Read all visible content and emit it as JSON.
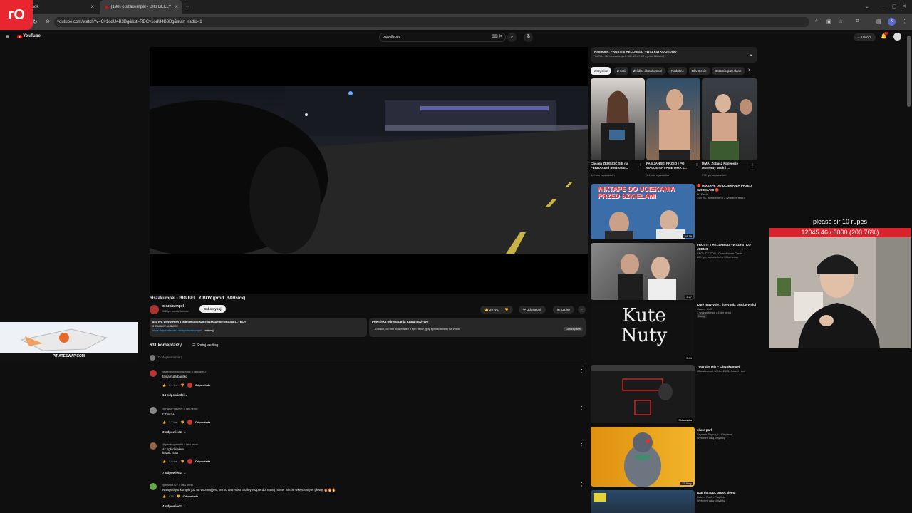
{
  "browser": {
    "tabs": [
      {
        "label": "ebook"
      },
      {
        "label": "(198) olszakumpel - BIG BELLY BOY..."
      }
    ],
    "url": "youtube.com/watch?v=Cv1odU4B3Bg&list=RDCv1odU4B3Bg&start_radio=1",
    "profile_initial": "K"
  },
  "youtube": {
    "logo_text": "YouTube",
    "search_value": "bigbellyboy",
    "create_label": "Utwórz",
    "notification_count": "9+"
  },
  "video": {
    "title": "olszakumpel - BIG BELLY BOY (prod. BAHsick)",
    "channel": "olszakumpel",
    "subscribers": "128 tys. subskrybentów",
    "subscribe_label": "Subskrybuj",
    "likes": "29 tys.",
    "share_label": "Udostępnij",
    "save_label": "Zapisz",
    "description_meta": "858 tys. wyświetleń  4 lata temu  #olsza #olszakumpel #BIGBELLYBOY",
    "description_line2": "3 ZAMÓW ALBUM!!",
    "description_link": "https://sprzedawacz.sklep/olszakumpel",
    "description_more": "...więcej",
    "chat_title": "Powtórka odtwarzania czatu na żywo",
    "chat_text": "Zobacz, co inni powiedzieli o tym filmie, gdy był nadawany na żywo.",
    "chat_button": "Otwórz panel"
  },
  "comments": {
    "count_label": "631 komentarzy",
    "sort_label": "Sortuj według",
    "add_placeholder": "Dodaj komentarz",
    "reply_label": "Odpowiedz",
    "items": [
      {
        "author": "@dejvik890kdmilymist",
        "time": "4 lata temu",
        "text": "fajna nuta bantko",
        "likes": "8,1 tys.",
        "replies": "14 odpowiedzi"
      },
      {
        "author": "@PanzPlatynov",
        "time": "4 lata temu",
        "text": "FIRE!!!1",
        "likes": "1,7 tys.",
        "replies": "3 odpowiedzi"
      },
      {
        "author": "@pawkopawelki",
        "time": "4 lata temu",
        "text": "aż zgłodniałem\nkozak nuta",
        "likes": "3,6 tys.",
        "replies": "7 odpowiedzi"
      },
      {
        "author": "@frank8727",
        "time": "4 lata temu",
        "text": "Na spotify'u kumple już od wczoraj jest, mimo wszystko totalny rozpierdol na tej nutce. Nieźle wkręca się w głowę 🔥🔥🔥",
        "likes": "478",
        "replies": "4 odpowiedzi"
      }
    ]
  },
  "sidebar": {
    "playlist_title": "Następny: FROSTI x HELLFIELD - WSZYSTKO JEDNO",
    "playlist_sub": "YouTube Mix – olszakumpel - BIG BELLY BOY (prod. BAHsick)",
    "chips": [
      "Wszystkie",
      "Z serii",
      "Źródło: olszakumpel",
      "Podobne",
      "Dla Ciebie",
      "Ostatnio przesłane"
    ],
    "shorts": [
      {
        "title": "Chciała ZEMŚCIĆ SIĘ na FERRARIM i poszło do...",
        "views": "1,6 mln wyświetleń"
      },
      {
        "title": "FABIJAŃSKI PRZED I PO WALCE NA FAME MMA 1...",
        "views": "1,4 mln wyświetleń"
      },
      {
        "title": "MMA: Zobacz Najlepsze Momenty Walk i ...",
        "views": "372 tys. wyświetleń"
      }
    ],
    "videos": [
      {
        "title": "🔴 MIXTAPE DO UCIEKANIA PRZED SZKIELAMI 🔴",
        "channel": "DJ Falda",
        "meta": "393 tys. wyświetleń • 2 tygodnie temu",
        "duration": "18:38",
        "thumb_text": "MIXTAPE DO UCIEKANIA PRZED SZKIELAMI"
      },
      {
        "title": "FROSTI x HELLFIELD - WSZYSTKO JEDNO",
        "channel": "SPOLICE ZDG / CrackHouse Cartel",
        "meta": "829 tys. wyświetleń • 11 lat temu",
        "duration": "3:27",
        "thumb_text": ""
      },
      {
        "title": "Kute nuty Vol#1 litery mix prod.WWaldi",
        "channel": "Czarny Coff",
        "meta": "3 wyświetlenia • 4 dni temu",
        "duration": "3:44",
        "badge": "Nowy",
        "thumb_text": "Kute Nuty"
      },
      {
        "title": "YouTube Mix – Olszakumpel",
        "channel": "Olszakumpel, White 2115, Gulczi i inni",
        "meta": "",
        "duration": "Składanka",
        "thumb_text": ""
      },
      {
        "title": "skate park",
        "channel": "Szymek Popczyk • Playlista",
        "meta": "Wyświetl całą playlistę",
        "duration": "23 filmy",
        "thumb_text": ""
      },
      {
        "title": "Rap do auta, prosy, dema",
        "channel": "Robert Radt • Playlista",
        "meta": "Wyświetl całą playlistę",
        "duration": "",
        "thumb_text": ""
      }
    ]
  },
  "stream_overlay": {
    "donation_text": "please sir 10 rupes",
    "goal_text": "12045.46 / 6000 (200.76%)"
  },
  "ad": {
    "caption": "PIRATESWAP.COM"
  },
  "colors": {
    "youtube_red": "#ff0000",
    "dark_bg": "#0f0f0f",
    "goal_bar": "#d8232d",
    "streamer_logo": "#e7262f"
  }
}
